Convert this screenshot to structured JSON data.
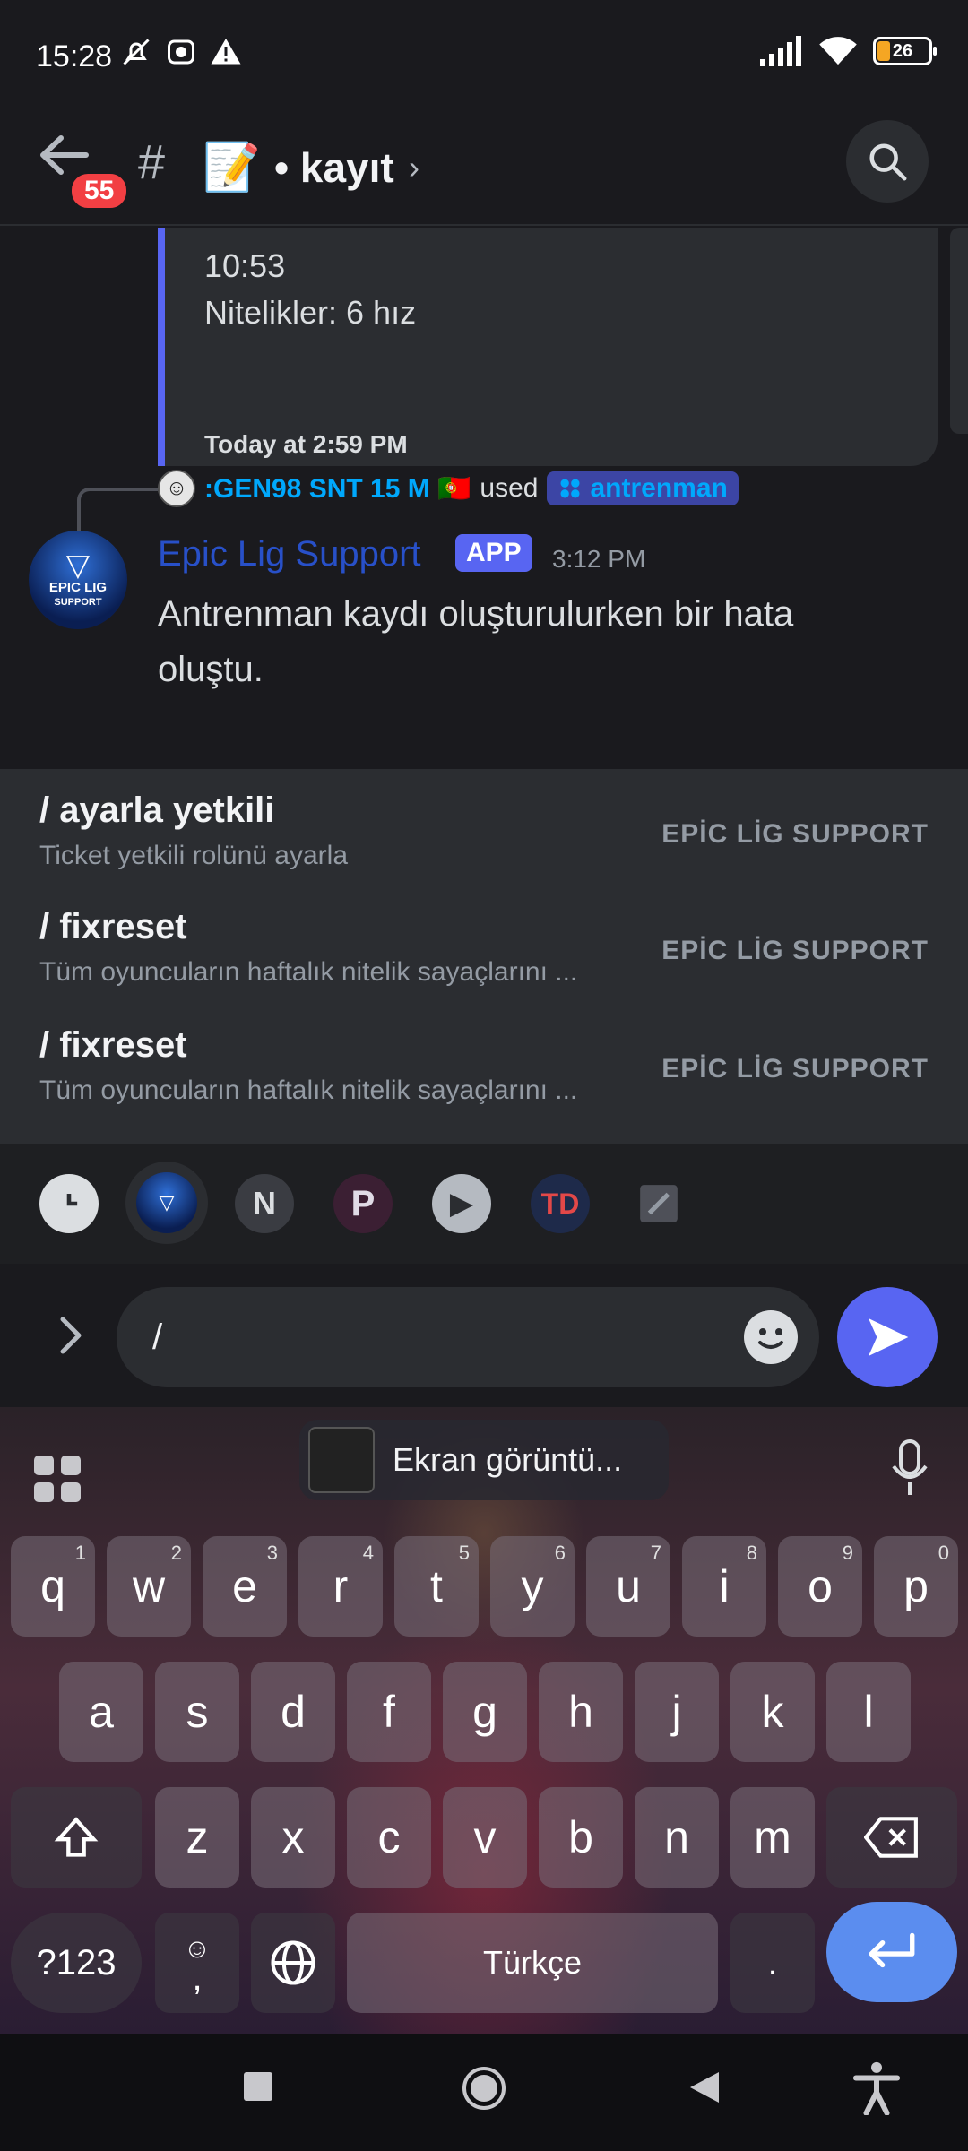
{
  "status_bar": {
    "time": "15:28",
    "battery": "26"
  },
  "header": {
    "unread_badge": "55",
    "channel_prefix": "#",
    "channel_emoji": "📝",
    "channel_name": "• kayıt",
    "chevron": "›"
  },
  "embed": {
    "line1": "10:53",
    "line2": "Nitelikler: 6 hız",
    "footer": "Today at 2:59 PM"
  },
  "reply": {
    "user": ":GEN98 SNT 15 M 🇵🇹",
    "used": "used",
    "command": "antrenman"
  },
  "message": {
    "avatar_text": "EPIC LIG",
    "avatar_sub": "SUPPORT",
    "author": "Epic Lig Support",
    "tag": "APP",
    "time": "3:12 PM",
    "text": "Antrenman kaydı oluşturulurken bir hata oluştu."
  },
  "autocomplete": [
    {
      "name": "/ ayarla yetkili",
      "desc": "Ticket yetkili rolünü ayarla",
      "source": "EPİC LİG SUPPORT"
    },
    {
      "name": "/ fixreset",
      "desc": "Tüm oyuncuların haftalık nitelik sayaçlarını ...",
      "source": "EPİC LİG SUPPORT"
    },
    {
      "name": "/ fixreset",
      "desc": "Tüm oyuncuların haftalık nitelik sayaçlarını ...",
      "source": "EPİC LİG SUPPORT"
    }
  ],
  "composer": {
    "value": "/"
  },
  "keyboard": {
    "clipboard_text": "Ekran görüntü...",
    "row1": [
      {
        "k": "q",
        "n": "1"
      },
      {
        "k": "w",
        "n": "2"
      },
      {
        "k": "e",
        "n": "3"
      },
      {
        "k": "r",
        "n": "4"
      },
      {
        "k": "t",
        "n": "5"
      },
      {
        "k": "y",
        "n": "6"
      },
      {
        "k": "u",
        "n": "7"
      },
      {
        "k": "i",
        "n": "8"
      },
      {
        "k": "o",
        "n": "9"
      },
      {
        "k": "p",
        "n": "0"
      }
    ],
    "row2": [
      "a",
      "s",
      "d",
      "f",
      "g",
      "h",
      "j",
      "k",
      "l"
    ],
    "row3": [
      "z",
      "x",
      "c",
      "v",
      "b",
      "n",
      "m"
    ],
    "symbols": "?123",
    "comma": ",",
    "space": "Türkçe",
    "period": "."
  },
  "colors": {
    "accent": "#5865f2",
    "link": "#00a8fc",
    "badge": "#f23f43"
  }
}
